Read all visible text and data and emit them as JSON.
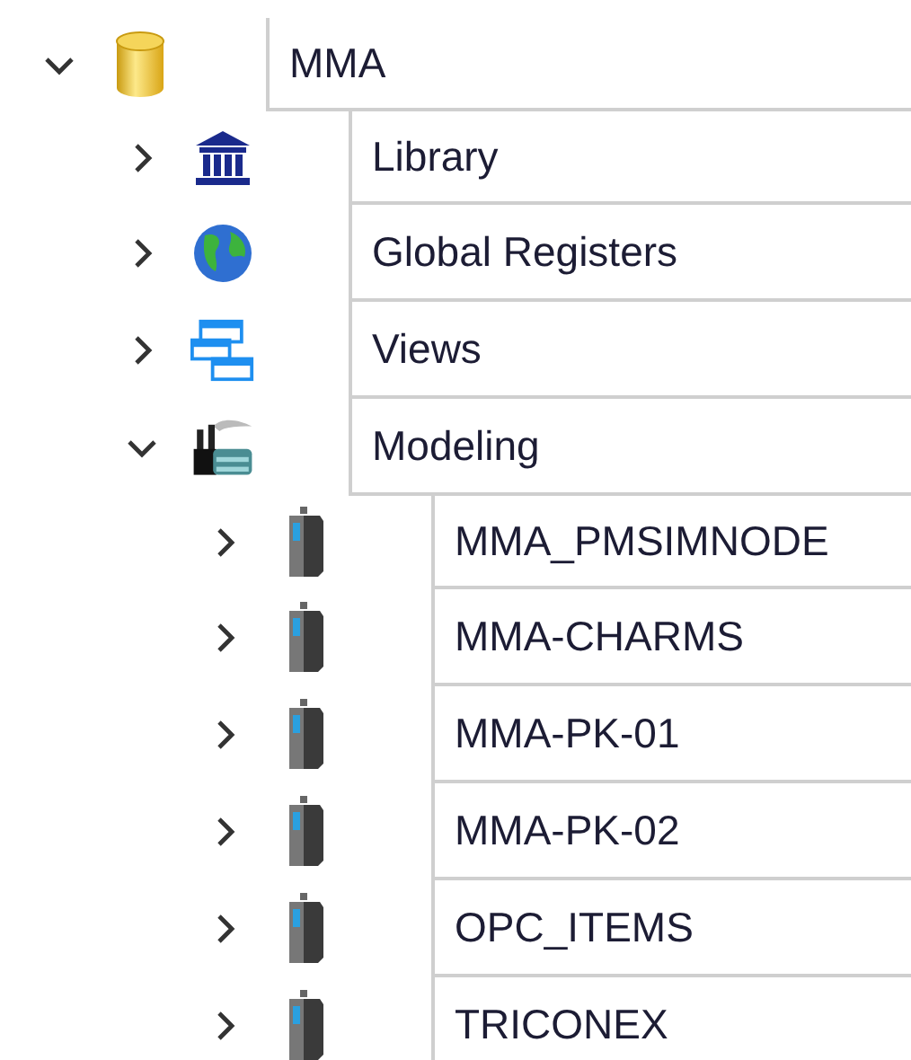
{
  "tree": [
    {
      "label": "MMA",
      "kind": "database",
      "expanded": true,
      "children": [
        {
          "label": "Library",
          "kind": "library",
          "expanded": false
        },
        {
          "label": "Global Registers",
          "kind": "globe",
          "expanded": false
        },
        {
          "label": "Views",
          "kind": "views",
          "expanded": false
        },
        {
          "label": "Modeling",
          "kind": "modeling",
          "expanded": true,
          "children": [
            {
              "label": "MMA_PMSIMNODE",
              "kind": "controller",
              "expanded": false
            },
            {
              "label": "MMA-CHARMS",
              "kind": "controller",
              "expanded": false
            },
            {
              "label": "MMA-PK-01",
              "kind": "controller",
              "expanded": false
            },
            {
              "label": "MMA-PK-02",
              "kind": "controller",
              "expanded": false
            },
            {
              "label": "OPC_ITEMS",
              "kind": "controller",
              "expanded": false
            },
            {
              "label": "TRICONEX",
              "kind": "controller",
              "expanded": false
            }
          ]
        }
      ]
    }
  ]
}
